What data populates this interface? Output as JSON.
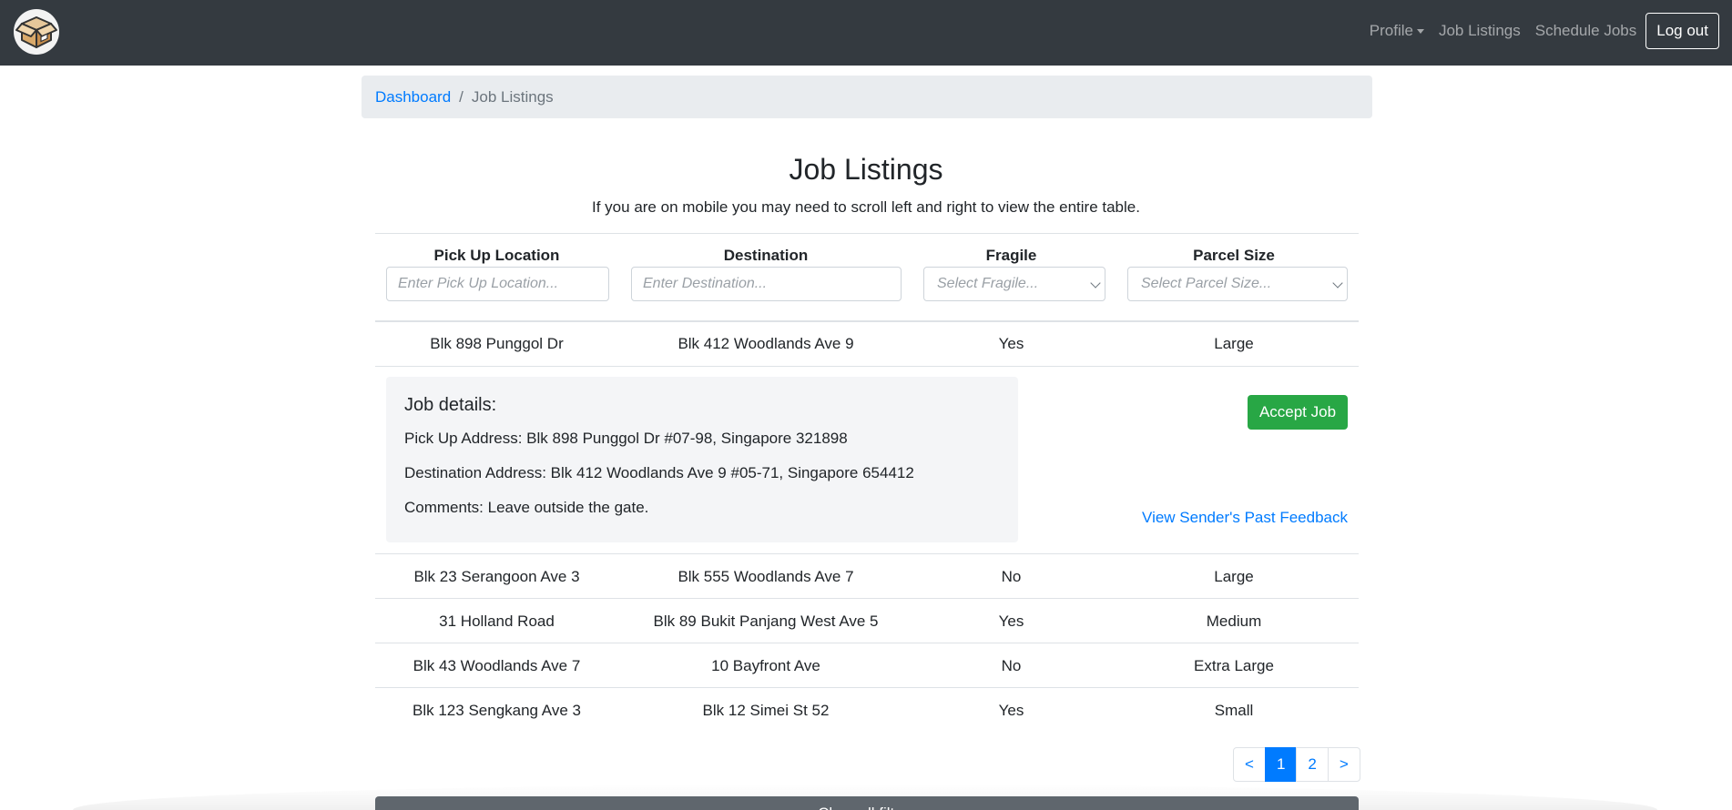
{
  "nav": {
    "brand_icon": "package-box-icon",
    "profile_label": "Profile",
    "job_listings_label": "Job Listings",
    "schedule_jobs_label": "Schedule Jobs",
    "logout_label": "Log out"
  },
  "breadcrumb": {
    "dashboard": "Dashboard",
    "separator": "/",
    "current": "Job Listings"
  },
  "page": {
    "title": "Job Listings",
    "subtitle": "If you are on mobile you may need to scroll left and right to view the entire table."
  },
  "table": {
    "headers": [
      "Pick Up Location",
      "Destination",
      "Fragile",
      "Parcel Size"
    ],
    "filters": {
      "pickup_placeholder": "Enter Pick Up Location...",
      "destination_placeholder": "Enter Destination...",
      "fragile_placeholder": "Select Fragile...",
      "size_placeholder": "Select Parcel Size..."
    },
    "rows": [
      {
        "pickup": "Blk 898 Punggol Dr",
        "destination": "Blk 412 Woodlands Ave 9",
        "fragile": "Yes",
        "size": "Large"
      },
      {
        "pickup": "Blk 23 Serangoon Ave 3",
        "destination": "Blk 555 Woodlands Ave 7",
        "fragile": "No",
        "size": "Large"
      },
      {
        "pickup": "31 Holland Road",
        "destination": "Blk 89 Bukit Panjang West Ave 5",
        "fragile": "Yes",
        "size": "Medium"
      },
      {
        "pickup": "Blk 43 Woodlands Ave 7",
        "destination": "10 Bayfront Ave",
        "fragile": "No",
        "size": "Extra Large"
      },
      {
        "pickup": "Blk 123 Sengkang Ave 3",
        "destination": "Blk 12 Simei St 52",
        "fragile": "Yes",
        "size": "Small"
      }
    ]
  },
  "details": {
    "title": "Job details:",
    "pickup_address": "Pick Up Address: Blk 898 Punggol Dr #07-98, Singapore 321898",
    "destination_address": "Destination Address: Blk 412 Woodlands Ave 9 #05-71, Singapore 654412",
    "comments": "Comments: Leave outside the gate.",
    "accept_label": "Accept Job",
    "feedback_label": "View Sender's Past Feedback"
  },
  "pagination": {
    "prev": "<",
    "pages": [
      "1",
      "2"
    ],
    "current_page": "1",
    "next": ">"
  },
  "clear_filters_label": "Clear all filters",
  "colors": {
    "navbar": "#343a40",
    "primary": "#007bff",
    "success": "#28a745",
    "secondary": "#5f666d"
  }
}
